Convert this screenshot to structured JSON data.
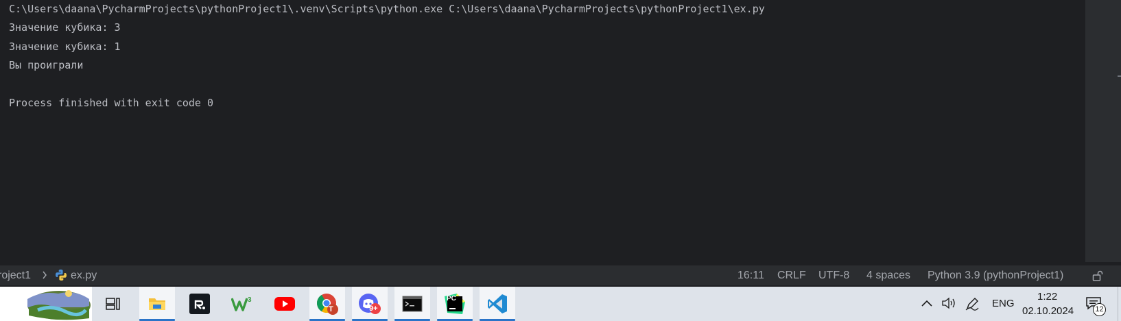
{
  "console": {
    "lines": [
      "C:\\Users\\daana\\PycharmProjects\\pythonProject1\\.venv\\Scripts\\python.exe C:\\Users\\daana\\PycharmProjects\\pythonProject1\\ex.py",
      "Значение кубика: 3",
      "Значение кубика: 1",
      "Вы проиграли",
      "",
      "Process finished with exit code 0"
    ]
  },
  "statusbar": {
    "breadcrumb": [
      "roject1",
      "ex.py"
    ],
    "cursor_position": "16:11",
    "line_separator": "CRLF",
    "encoding": "UTF-8",
    "indent": "4 spaces",
    "interpreter": "Python 3.9 (pythonProject1)",
    "icons": {
      "file": "python-file-icon",
      "readonly": "lock-icon",
      "separator": "chevron-right-icon"
    }
  },
  "taskbar": {
    "apps": [
      {
        "name": "task-view",
        "icon": "task-view-icon",
        "active": false
      },
      {
        "name": "file-explorer",
        "icon": "folder-icon",
        "active": true
      },
      {
        "name": "rutube",
        "icon": "rutube-icon",
        "active": false
      },
      {
        "name": "w3",
        "icon": "w3-icon",
        "active": false
      },
      {
        "name": "youtube",
        "icon": "youtube-icon",
        "active": false
      },
      {
        "name": "chrome",
        "icon": "chrome-icon",
        "active": true,
        "badge": "T"
      },
      {
        "name": "discord",
        "icon": "discord-icon",
        "active": true,
        "badge": "9+"
      },
      {
        "name": "terminal",
        "icon": "terminal-icon",
        "active": true
      },
      {
        "name": "pycharm",
        "icon": "pycharm-icon",
        "active": true,
        "label": "PC"
      },
      {
        "name": "vscode",
        "icon": "vscode-icon",
        "active": true
      }
    ],
    "tray": {
      "language": "ENG",
      "time": "1:22",
      "date": "02.10.2024",
      "notifications": "12"
    }
  },
  "colors": {
    "console_bg": "#1e1f22",
    "console_text": "#bcbec4",
    "statusbar_bg": "#2b2d30",
    "taskbar_bg": "#dee3ea",
    "active_indicator": "#2b74c8"
  }
}
